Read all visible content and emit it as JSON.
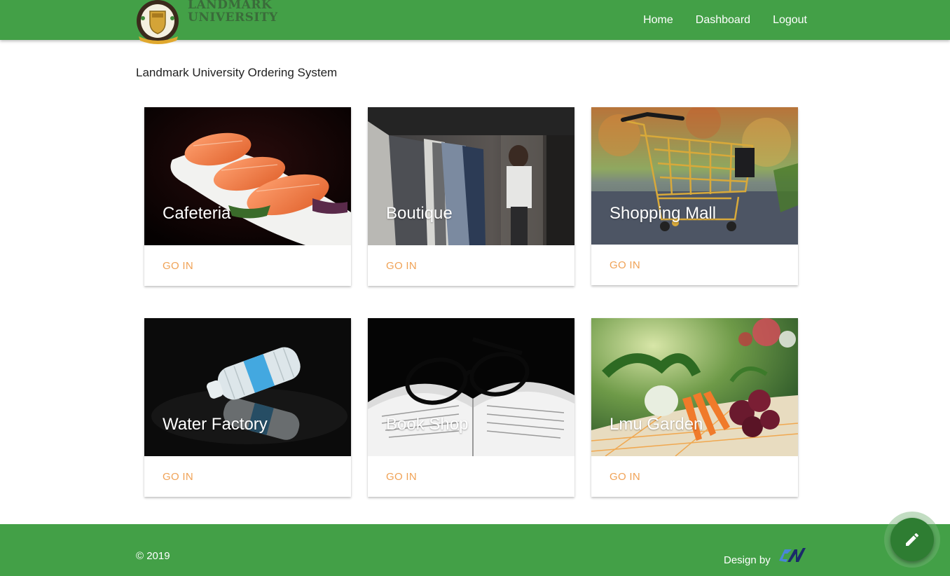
{
  "header": {
    "brand_line1": "LANDMARK",
    "brand_line2": "UNIVERSITY",
    "nav": [
      "Home",
      "Dashboard",
      "Logout"
    ]
  },
  "page_title": "Landmark University Ordering System",
  "cards": [
    {
      "title": "Cafeteria",
      "action": "GO IN",
      "image": "salmon-plate"
    },
    {
      "title": "Boutique",
      "action": "GO IN",
      "image": "clothes-rack"
    },
    {
      "title": "Shopping Mall",
      "action": "GO IN",
      "image": "shopping-cart"
    },
    {
      "title": "Water Factory",
      "action": "GO IN",
      "image": "water-bottle"
    },
    {
      "title": "Book Shop",
      "action": "GO IN",
      "image": "book-glasses"
    },
    {
      "title": "Lmu Garden",
      "action": "GO IN",
      "image": "vegetable-basket"
    }
  ],
  "footer": {
    "copyright": "© 2019",
    "design_by": "Design by"
  },
  "fab": {
    "icon": "pencil-icon"
  },
  "colors": {
    "primary": "#43a047",
    "fab": "#2e7d32",
    "action": "#f0a256"
  }
}
